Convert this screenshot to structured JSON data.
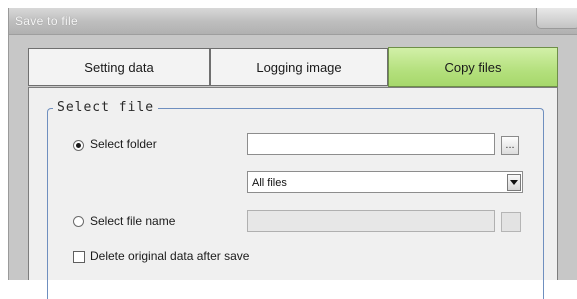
{
  "window": {
    "title": "Save to file"
  },
  "tabs": [
    {
      "label": "Setting data",
      "active": false
    },
    {
      "label": "Logging image",
      "active": false
    },
    {
      "label": "Copy files",
      "active": true
    }
  ],
  "group": {
    "legend": "Select file",
    "select_folder_label": "Select folder",
    "select_folder_checked": true,
    "folder_path_value": "",
    "browse_label": "...",
    "filter_value": "All files",
    "select_file_name_label": "Select file name",
    "file_name_value": "",
    "delete_label": "Delete original data after save",
    "delete_checked": false
  },
  "colors": {
    "active_tab": "#b4e07d",
    "group_border": "#6f8fbf"
  }
}
